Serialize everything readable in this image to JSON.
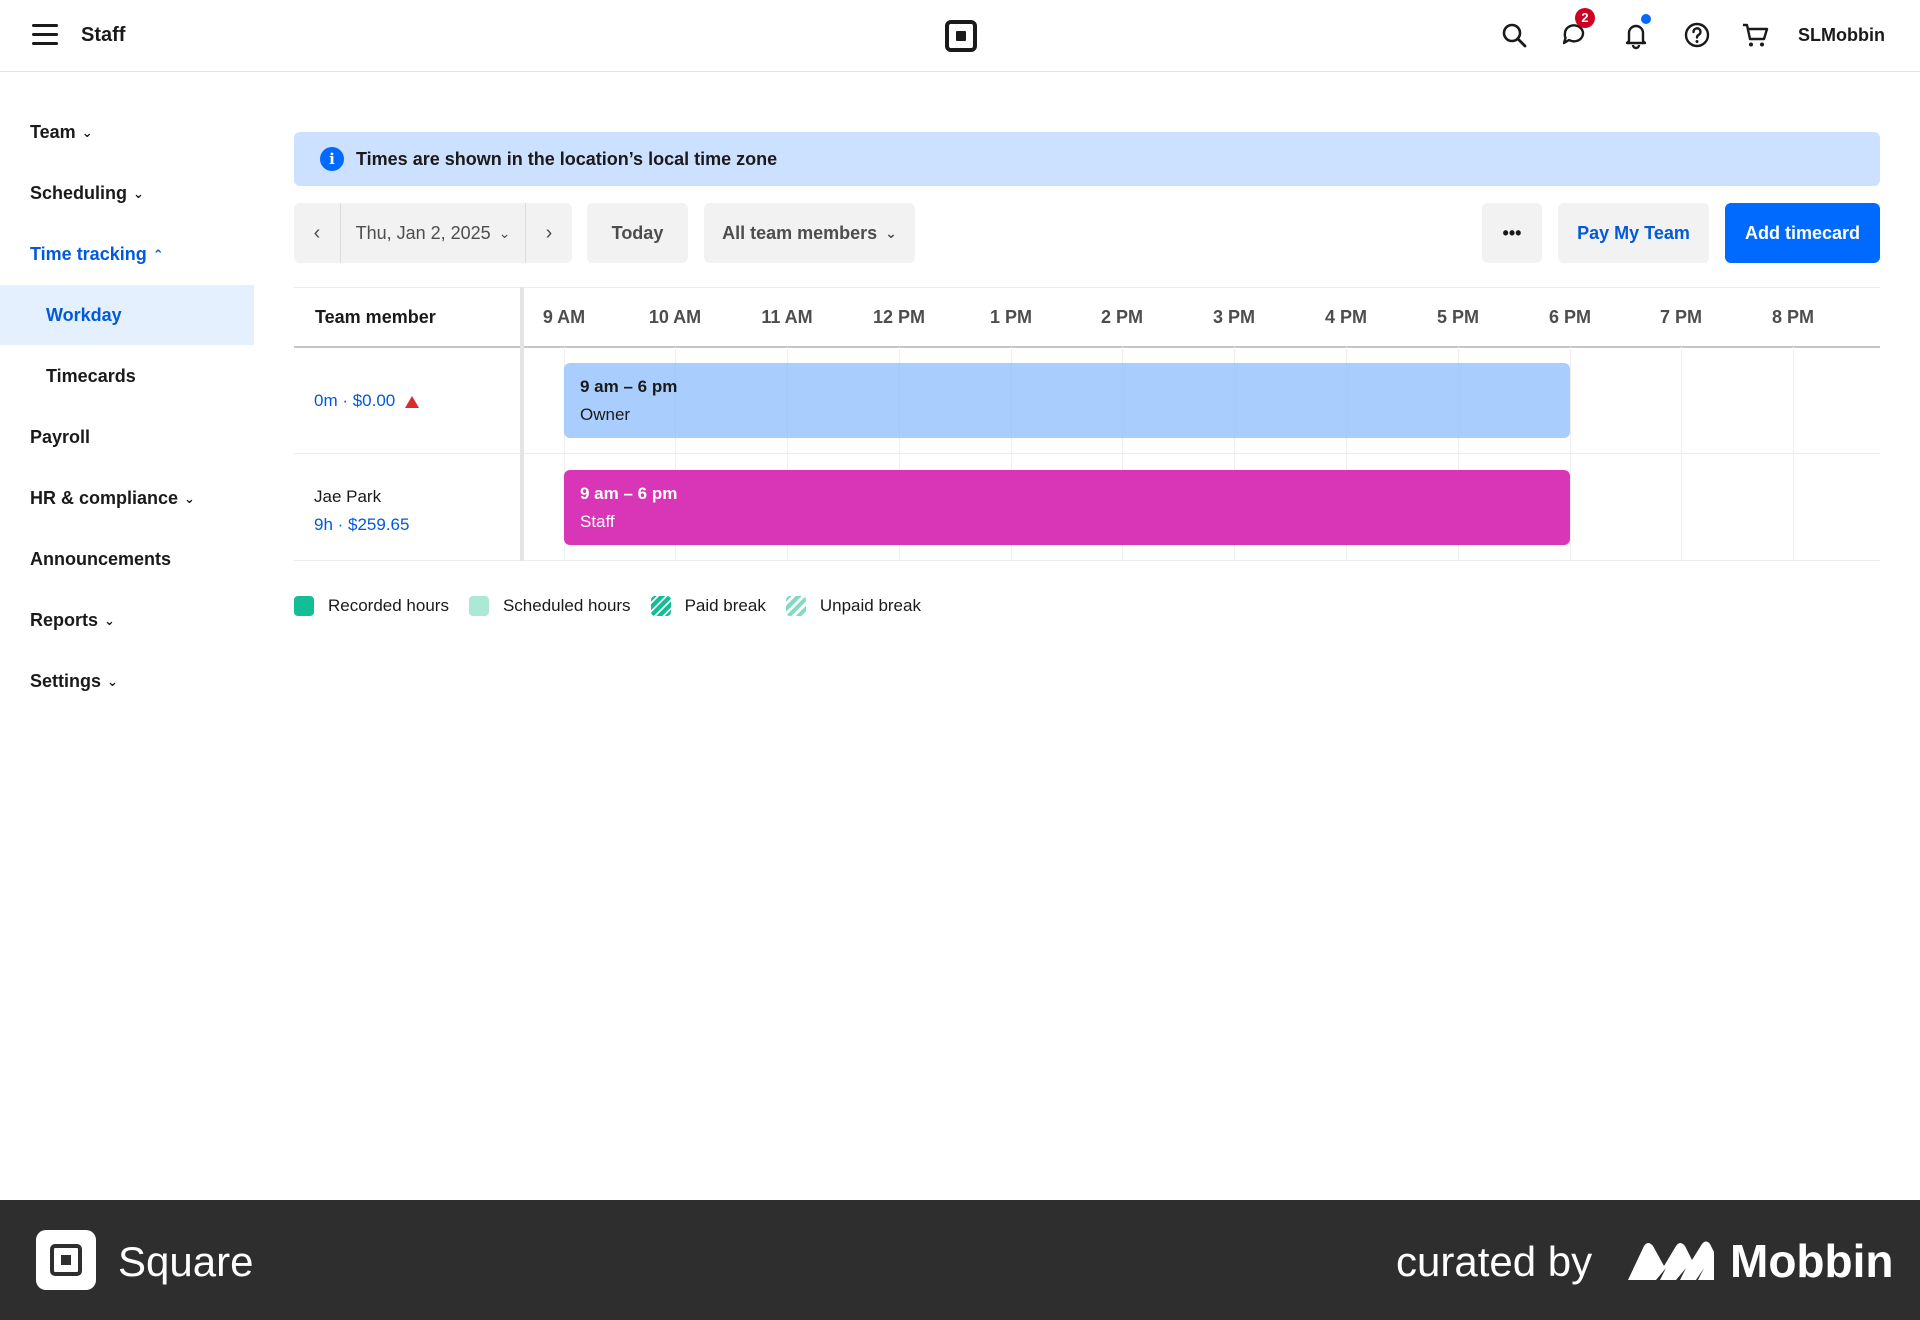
{
  "header": {
    "title": "Staff",
    "messages_badge": "2",
    "account_name": "SLMobbin",
    "icons": [
      "menu-icon",
      "square-logo-icon",
      "search-icon",
      "messages-icon",
      "bell-icon",
      "help-icon",
      "cart-icon"
    ]
  },
  "sidebar": {
    "items": [
      {
        "label": "Team",
        "chevron": "down"
      },
      {
        "label": "Scheduling",
        "chevron": "down"
      },
      {
        "label": "Time tracking",
        "chevron": "up",
        "active": true
      },
      {
        "label": "Workday",
        "sub": true,
        "selected": true
      },
      {
        "label": "Timecards",
        "sub": true
      },
      {
        "label": "Payroll"
      },
      {
        "label": "HR & compliance",
        "chevron": "down"
      },
      {
        "label": "Announcements"
      },
      {
        "label": "Reports",
        "chevron": "down"
      },
      {
        "label": "Settings",
        "chevron": "down"
      }
    ]
  },
  "banner": {
    "text": "Times are shown in the location’s local time zone",
    "icon": "info-icon"
  },
  "toolbar": {
    "date": "Thu, Jan 2, 2025",
    "today": "Today",
    "filter": "All team members",
    "more": "•••",
    "pay_team": "Pay My Team",
    "add_timecard": "Add timecard"
  },
  "timeline": {
    "member_header": "Team member",
    "hours": [
      "9 AM",
      "10 AM",
      "11 AM",
      "12 PM",
      "1 PM",
      "2 PM",
      "3 PM",
      "4 PM",
      "5 PM",
      "6 PM",
      "7 PM",
      "8 PM"
    ],
    "rows": [
      {
        "name": "",
        "summary": "0m · $0.00",
        "warning": true,
        "shift_time": "9 am – 6 pm",
        "shift_role": "Owner",
        "color": "#8cbefc"
      },
      {
        "name": "Jae Park",
        "summary": "9h · $259.65",
        "warning": false,
        "shift_time": "9 am – 6 pm",
        "shift_role": "Staff",
        "color": "#d936b7"
      }
    ]
  },
  "legend": {
    "items": [
      {
        "label": "Recorded hours",
        "color": "#12bf94"
      },
      {
        "label": "Scheduled hours",
        "color": "#abe9d6"
      },
      {
        "label": "Paid break",
        "color": "#12bf94"
      },
      {
        "label": "Unpaid break",
        "color": "#7fdcc0"
      }
    ]
  },
  "footer": {
    "brand": "Square",
    "curated": "curated by",
    "mobbin": "Mobbin"
  }
}
